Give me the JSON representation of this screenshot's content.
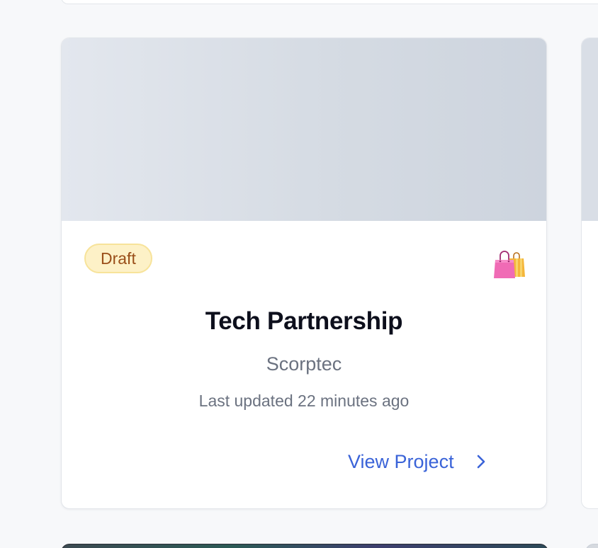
{
  "project_card": {
    "status_badge": "Draft",
    "status_colors": {
      "background": "#fdf1c7",
      "border": "#f7e39a",
      "text": "#9a4f1a"
    },
    "category_icon": "shopping-bags-icon",
    "title": "Tech Partnership",
    "client": "Scorptec",
    "last_updated": "Last updated 22 minutes ago",
    "view_link_label": "View Project",
    "accent_color": "#3a63d8"
  }
}
